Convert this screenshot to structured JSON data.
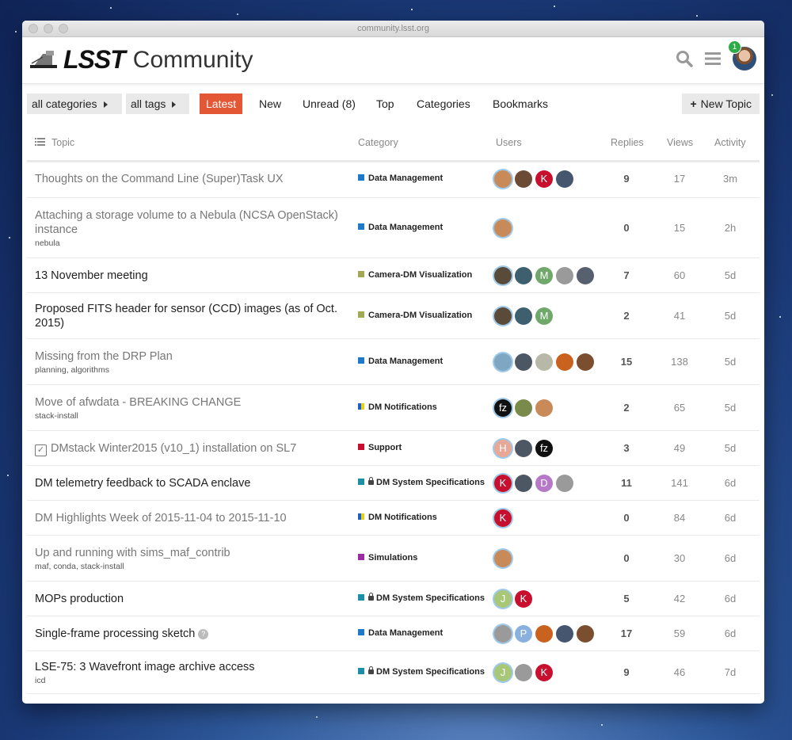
{
  "browser": {
    "url": "community.lsst.org"
  },
  "header": {
    "logo_text": "LSST",
    "site_name": "Community",
    "notification_count": "1",
    "icons": [
      "search-icon",
      "hamburger-menu-icon",
      "user-avatar"
    ]
  },
  "nav": {
    "categories_dropdown": "all categories",
    "tags_dropdown": "all tags",
    "tabs": [
      "Latest",
      "New",
      "Unread (8)",
      "Top",
      "Categories",
      "Bookmarks"
    ],
    "active_tab": "Latest",
    "new_topic": "New Topic",
    "accent_color": "#e45735"
  },
  "columns": {
    "topic": "Topic",
    "category": "Category",
    "users": "Users",
    "replies": "Replies",
    "views": "Views",
    "activity": "Activity"
  },
  "topics": [
    {
      "title": "Thoughts on the Command Line (Super)Task UX",
      "visited": true,
      "tags": "",
      "category": "Data Management",
      "cat_color": "#1f78c8",
      "locked": false,
      "users": [
        {
          "c": "#c98a5a",
          "t": ""
        },
        {
          "c": "#6b4a36",
          "t": ""
        },
        {
          "c": "#c8102e",
          "t": "K"
        },
        {
          "c": "#44576e",
          "t": ""
        }
      ],
      "replies": "9",
      "views": "17",
      "activity": "3m"
    },
    {
      "title": "Attaching a storage volume to a Nebula (NCSA OpenStack) instance",
      "visited": true,
      "tags": "nebula",
      "category": "Data Management",
      "cat_color": "#1f78c8",
      "locked": false,
      "users": [
        {
          "c": "#c98a5a",
          "t": ""
        }
      ],
      "replies": "0",
      "views": "15",
      "activity": "2h"
    },
    {
      "title": "13 November meeting",
      "visited": false,
      "tags": "",
      "category": "Camera-DM Visualization",
      "cat_color": "#a3a854",
      "locked": false,
      "users": [
        {
          "c": "#5a4a3a",
          "t": ""
        },
        {
          "c": "#3e5f6e",
          "t": ""
        },
        {
          "c": "#6fa86a",
          "t": "M"
        },
        {
          "c": "#9a9a9a",
          "t": ""
        },
        {
          "c": "#56606e",
          "t": ""
        }
      ],
      "replies": "7",
      "views": "60",
      "activity": "5d"
    },
    {
      "title": "Proposed FITS header for sensor (CCD) images (as of Oct. 2015)",
      "visited": false,
      "tags": "",
      "category": "Camera-DM Visualization",
      "cat_color": "#a3a854",
      "locked": false,
      "users": [
        {
          "c": "#5a4a3a",
          "t": ""
        },
        {
          "c": "#3e5f6e",
          "t": ""
        },
        {
          "c": "#6fa86a",
          "t": "M"
        }
      ],
      "replies": "2",
      "views": "41",
      "activity": "5d"
    },
    {
      "title": "Missing from the DRP Plan",
      "visited": true,
      "tags": "planning, algorithms",
      "category": "Data Management",
      "cat_color": "#1f78c8",
      "locked": false,
      "users": [
        {
          "c": "#7fa7c4",
          "t": ""
        },
        {
          "c": "#4d5663",
          "t": ""
        },
        {
          "c": "#b8b8a8",
          "t": ""
        },
        {
          "c": "#c8621e",
          "t": ""
        },
        {
          "c": "#7a4e2e",
          "t": ""
        }
      ],
      "replies": "15",
      "views": "138",
      "activity": "5d"
    },
    {
      "title": "Move of afwdata - BREAKING CHANGE",
      "visited": true,
      "tags": "stack-install",
      "category": "DM Notifications",
      "cat_color": "#1f5fbf",
      "cat_color2": "#e3d21a",
      "locked": false,
      "users": [
        {
          "c": "#111111",
          "t": "fz"
        },
        {
          "c": "#7a8a4a",
          "t": ""
        },
        {
          "c": "#c98a5a",
          "t": ""
        }
      ],
      "replies": "2",
      "views": "65",
      "activity": "5d"
    },
    {
      "title": "DMstack Winter2015 (v10_1) installation on SL7",
      "visited": true,
      "pinned": true,
      "tags": "",
      "category": "Support",
      "cat_color": "#c8102e",
      "locked": false,
      "users": [
        {
          "c": "#e8a898",
          "t": "H"
        },
        {
          "c": "#4d5663",
          "t": ""
        },
        {
          "c": "#111111",
          "t": "fz"
        }
      ],
      "replies": "3",
      "views": "49",
      "activity": "5d"
    },
    {
      "title": "DM telemetry feedback to SCADA enclave",
      "visited": false,
      "tags": "",
      "category": "DM System Specifications",
      "cat_color": "#1c8fa6",
      "locked": true,
      "users": [
        {
          "c": "#c8102e",
          "t": "K"
        },
        {
          "c": "#4d5663",
          "t": ""
        },
        {
          "c": "#b579c7",
          "t": "D"
        },
        {
          "c": "#9a9a9a",
          "t": ""
        }
      ],
      "replies": "11",
      "views": "141",
      "activity": "6d"
    },
    {
      "title": "DM Highlights Week of 2015-11-04 to 2015-11-10",
      "visited": true,
      "tags": "",
      "category": "DM Notifications",
      "cat_color": "#1f5fbf",
      "cat_color2": "#e3d21a",
      "locked": false,
      "users": [
        {
          "c": "#c8102e",
          "t": "K"
        }
      ],
      "replies": "0",
      "views": "84",
      "activity": "6d"
    },
    {
      "title": "Up and running with sims_maf_contrib",
      "visited": true,
      "tags": "maf, conda, stack-install",
      "category": "Simulations",
      "cat_color": "#9b2ca6",
      "locked": false,
      "users": [
        {
          "c": "#c98a5a",
          "t": ""
        }
      ],
      "replies": "0",
      "views": "30",
      "activity": "6d"
    },
    {
      "title": "MOPs production",
      "visited": false,
      "tags": "",
      "category": "DM System Specifications",
      "cat_color": "#1c8fa6",
      "locked": true,
      "users": [
        {
          "c": "#a8c878",
          "t": "J"
        },
        {
          "c": "#c8102e",
          "t": "K"
        }
      ],
      "replies": "5",
      "views": "42",
      "activity": "6d"
    },
    {
      "title": "Single-frame processing sketch",
      "visited": false,
      "question": true,
      "tags": "",
      "category": "Data Management",
      "cat_color": "#1f78c8",
      "locked": false,
      "users": [
        {
          "c": "#9a9a9a",
          "t": ""
        },
        {
          "c": "#8ab0e0",
          "t": "P"
        },
        {
          "c": "#c8621e",
          "t": ""
        },
        {
          "c": "#44576e",
          "t": ""
        },
        {
          "c": "#7a4e2e",
          "t": ""
        }
      ],
      "replies": "17",
      "views": "59",
      "activity": "6d"
    },
    {
      "title": "LSE-75: 3 Wavefront image archive access",
      "visited": false,
      "tags": "icd",
      "category": "DM System Specifications",
      "cat_color": "#1c8fa6",
      "locked": true,
      "users": [
        {
          "c": "#a8c878",
          "t": "J"
        },
        {
          "c": "#9a9a9a",
          "t": ""
        },
        {
          "c": "#c8102e",
          "t": "K"
        }
      ],
      "replies": "9",
      "views": "46",
      "activity": "7d"
    }
  ]
}
